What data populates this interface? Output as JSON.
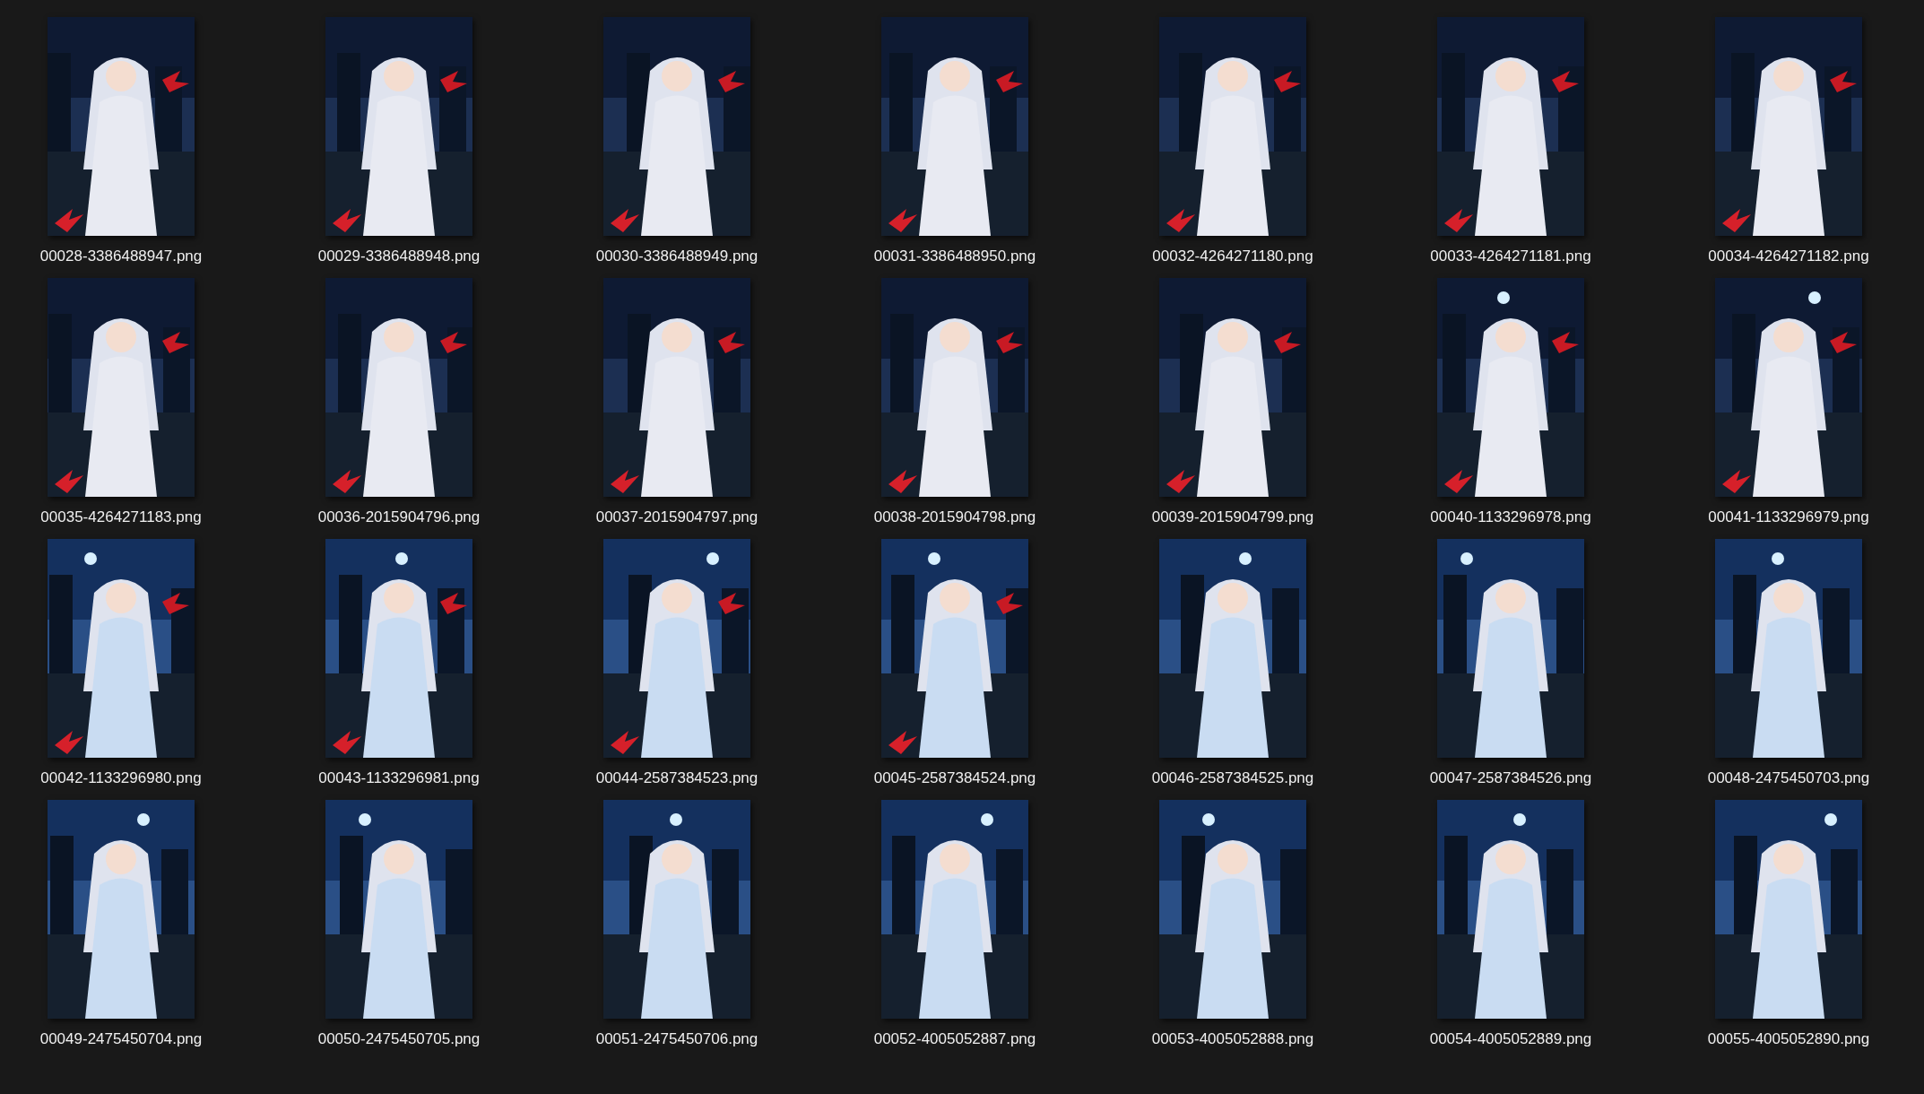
{
  "files": [
    {
      "name": "00028-3386488947.png"
    },
    {
      "name": "00029-3386488948.png"
    },
    {
      "name": "00030-3386488949.png"
    },
    {
      "name": "00031-3386488950.png"
    },
    {
      "name": "00032-4264271180.png"
    },
    {
      "name": "00033-4264271181.png"
    },
    {
      "name": "00034-4264271182.png"
    },
    {
      "name": "00035-4264271183.png"
    },
    {
      "name": "00036-2015904796.png"
    },
    {
      "name": "00037-2015904797.png"
    },
    {
      "name": "00038-2015904798.png"
    },
    {
      "name": "00039-2015904799.png"
    },
    {
      "name": "00040-1133296978.png"
    },
    {
      "name": "00041-1133296979.png"
    },
    {
      "name": "00042-1133296980.png"
    },
    {
      "name": "00043-1133296981.png"
    },
    {
      "name": "00044-2587384523.png"
    },
    {
      "name": "00045-2587384524.png"
    },
    {
      "name": "00046-2587384525.png"
    },
    {
      "name": "00047-2587384526.png"
    },
    {
      "name": "00048-2475450703.png"
    },
    {
      "name": "00049-2475450704.png"
    },
    {
      "name": "00050-2475450705.png"
    },
    {
      "name": "00051-2475450706.png"
    },
    {
      "name": "00052-4005052887.png"
    },
    {
      "name": "00053-4005052888.png"
    },
    {
      "name": "00054-4005052889.png"
    },
    {
      "name": "00055-4005052890.png"
    }
  ]
}
